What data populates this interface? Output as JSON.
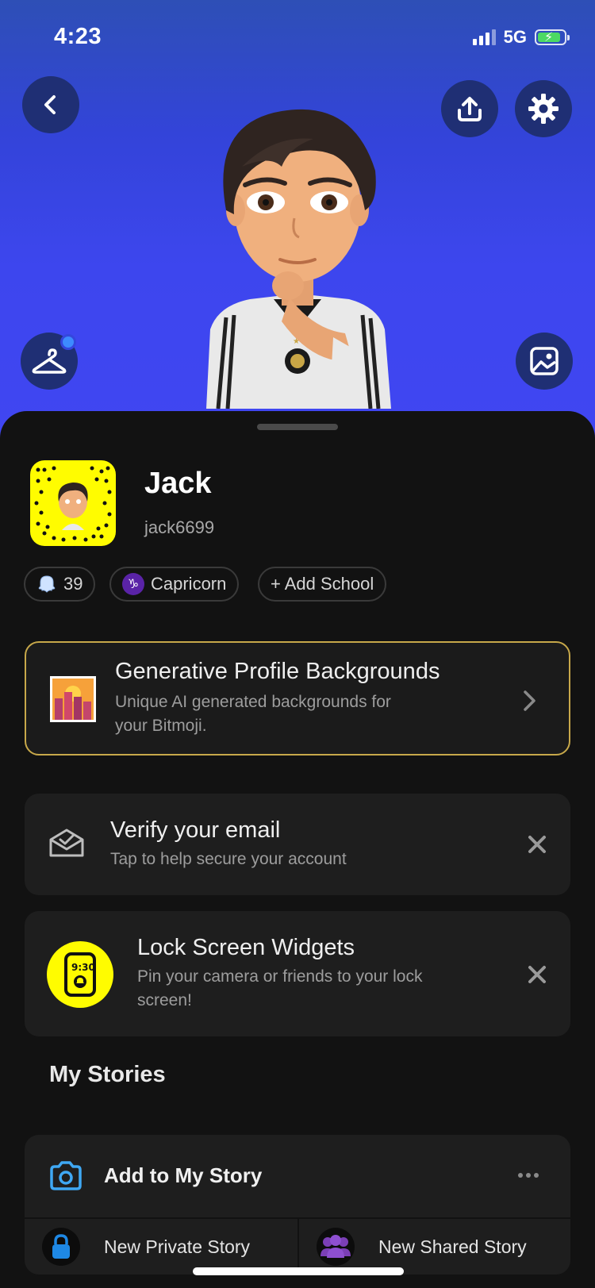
{
  "status": {
    "time": "4:23",
    "network": "5G"
  },
  "profile": {
    "display_name": "Jack",
    "username": "jack6699"
  },
  "pills": {
    "score": "39",
    "zodiac_symbol": "♑",
    "zodiac": "Capricorn",
    "add_school": "+ Add School"
  },
  "promo": {
    "title": "Generative Profile Backgrounds",
    "subtitle_line1": "Unique AI generated backgrounds for",
    "subtitle_line2": "your Bitmoji."
  },
  "verify_email": {
    "title": "Verify your email",
    "subtitle": "Tap to help secure your account"
  },
  "widgets": {
    "title": "Lock Screen Widgets",
    "subtitle_line1": "Pin your camera or friends to your lock",
    "subtitle_line2": "screen!",
    "icon_time": "9:30"
  },
  "stories": {
    "section_title": "My Stories",
    "add_label": "Add to My Story",
    "private_label": "New Private Story",
    "shared_label": "New Shared Story"
  },
  "colors": {
    "hero_blue": "#3d46ee",
    "snap_yellow": "#fffc00",
    "promo_border": "#c7a84a",
    "camera_blue": "#3fa8f4",
    "lock_blue": "#1e88e5",
    "shared_purple": "#7b3fb6"
  }
}
